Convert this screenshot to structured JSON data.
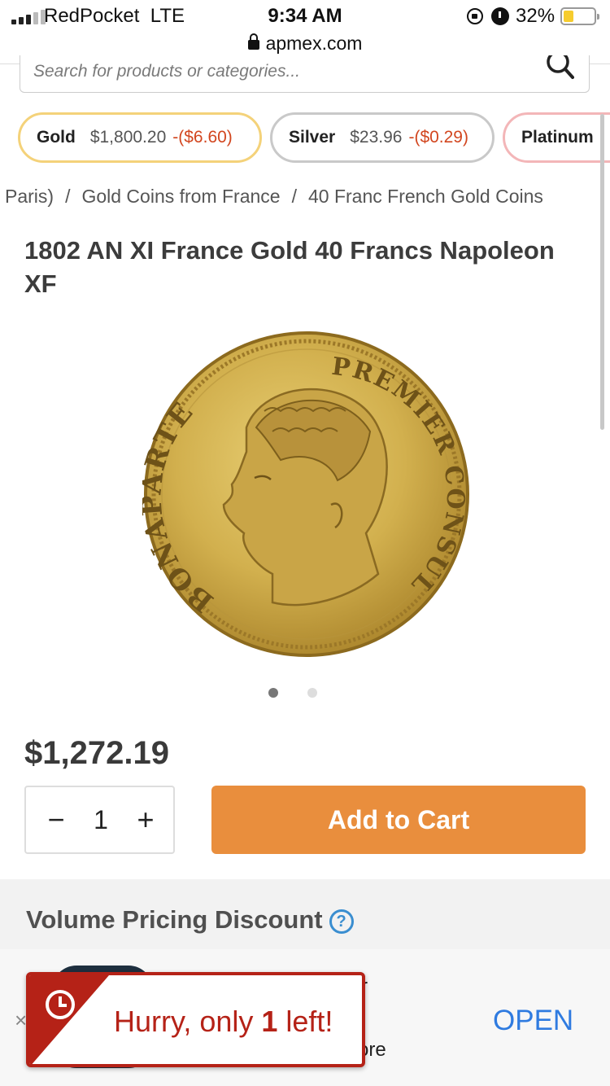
{
  "status_bar": {
    "carrier": "RedPocket",
    "network": "LTE",
    "time": "9:34 AM",
    "battery": "32%",
    "battery_level": 0.32,
    "url": "apmex.com"
  },
  "search": {
    "placeholder": "Search for products or categories..."
  },
  "tickers": [
    {
      "metal": "Gold",
      "price": "$1,800.20",
      "change": "-($6.60)"
    },
    {
      "metal": "Silver",
      "price": "$23.96",
      "change": "-($0.29)"
    },
    {
      "metal": "Platinum"
    }
  ],
  "breadcrumb": [
    "Paris)",
    "Gold Coins from France",
    "40 Franc French Gold Coins"
  ],
  "product": {
    "title": "1802 AN XI France Gold 40 Francs Napoleon XF",
    "price": "$1,272.19",
    "quantity": "1",
    "add_to_cart": "Add to Cart",
    "image_legend_left": "BONAPARTE",
    "image_legend_right": "PREMIER CONSUL",
    "image_count": 2,
    "active_image": 1
  },
  "volume": {
    "title": "Volume Pricing Discount"
  },
  "app_banner": {
    "text_top": "r",
    "text_bottom": "ore",
    "open": "OPEN",
    "close": "×"
  },
  "toast": {
    "prefix": "Hurry, only ",
    "count": "1",
    "suffix": " left!"
  },
  "colors": {
    "accent_orange": "#e98e3d",
    "price_down": "#d2461f",
    "toast_red": "#b52217",
    "link_blue": "#2f7be0"
  }
}
